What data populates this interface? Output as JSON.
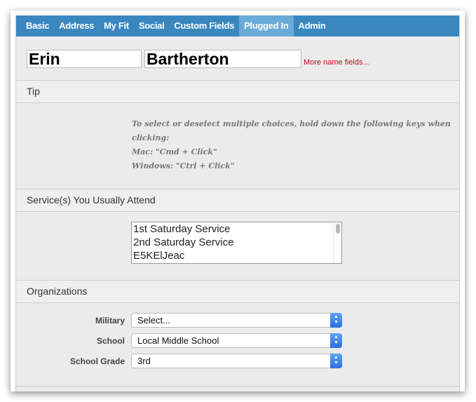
{
  "tabs": [
    {
      "label": "Basic"
    },
    {
      "label": "Address"
    },
    {
      "label": "My Fit"
    },
    {
      "label": "Social"
    },
    {
      "label": "Custom Fields"
    },
    {
      "label": "Plugged In",
      "active": true
    },
    {
      "label": "Admin"
    }
  ],
  "name": {
    "first": "Erin",
    "last": "Bartherton",
    "more_link": "More name fields..."
  },
  "tip": {
    "header": "Tip",
    "line1": "To select or deselect multiple choices, hold down the following keys when clicking:",
    "line2": "Mac: \"Cmd + Click\"",
    "line3": "Windows: \"Ctrl + Click\""
  },
  "services": {
    "header": "Service(s) You Usually Attend",
    "options": [
      "1st Saturday Service",
      "2nd Saturday Service",
      "E5KElJeac"
    ]
  },
  "organizations": {
    "header": "Organizations",
    "fields": [
      {
        "label": "Military",
        "value": "Select..."
      },
      {
        "label": "School",
        "value": "Local Middle School"
      },
      {
        "label": "School Grade",
        "value": "3rd"
      }
    ]
  },
  "colors": {
    "tab_bar": "#3a87c0",
    "active_tab": "#6aaad6",
    "link": "#d0021b"
  }
}
